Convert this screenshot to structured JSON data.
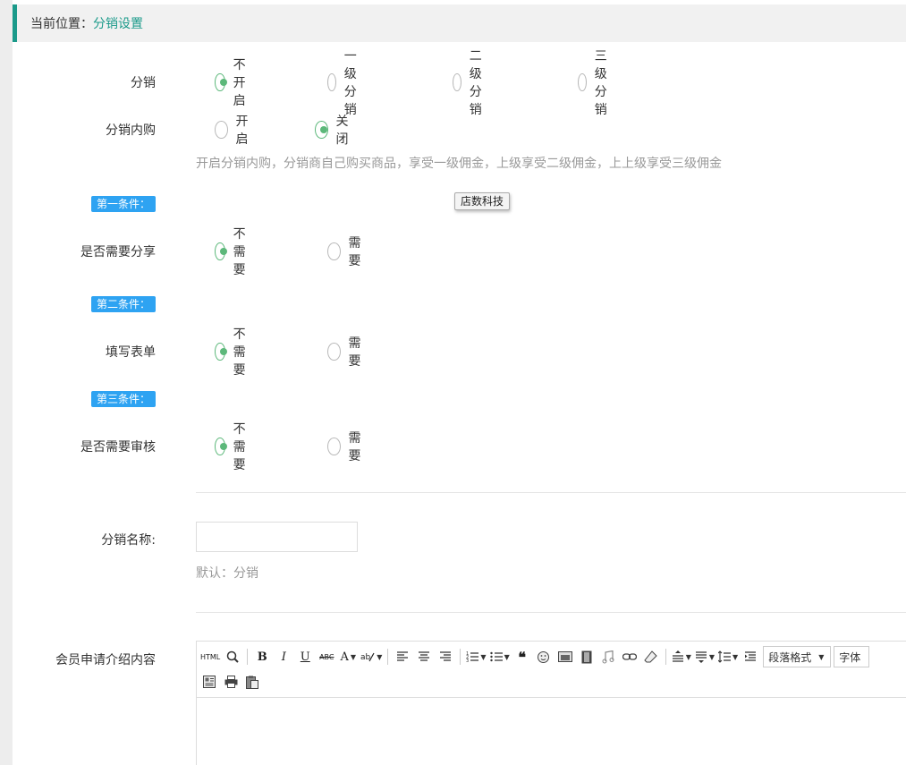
{
  "breadcrumb": {
    "prefix": "当前位置：",
    "current": "分销设置"
  },
  "rows": {
    "distribution": {
      "label": "分销",
      "options": [
        "不开启",
        "一级分销",
        "二级分销",
        "三级分销"
      ],
      "selected": 0
    },
    "internal_purchase": {
      "label": "分销内购",
      "options": [
        "开启",
        "关闭"
      ],
      "selected": 1
    },
    "need_share": {
      "label": "是否需要分享",
      "options": [
        "不需要",
        "需要"
      ],
      "selected": 0
    },
    "fill_form": {
      "label": "填写表单",
      "options": [
        "不需要",
        "需要"
      ],
      "selected": 0
    },
    "need_review": {
      "label": "是否需要审核",
      "options": [
        "不需要",
        "需要"
      ],
      "selected": 0
    }
  },
  "help_text": "开启分销内购，分销商自己购买商品，享受一级佣金，上级享受二级佣金，上上级享受三级佣金",
  "tags": {
    "first": "第一条件：",
    "second": "第二条件：",
    "third": "第三条件："
  },
  "tooltip": "店数科技",
  "name_field": {
    "label": "分销名称:",
    "value": "",
    "default_hint": "默认：分销"
  },
  "intro": {
    "label": "会员申请介绍内容"
  },
  "editor": {
    "html_label": "HTML",
    "bold": "B",
    "italic": "I",
    "underline": "U",
    "strike": "ABC",
    "font_color": "A",
    "paragraph_format": "段落格式",
    "font_family": "字体"
  },
  "colors": {
    "accent": "#1b9a8a",
    "radio_checked": "#5cb87a",
    "tag_bg": "#2ea3f2"
  }
}
